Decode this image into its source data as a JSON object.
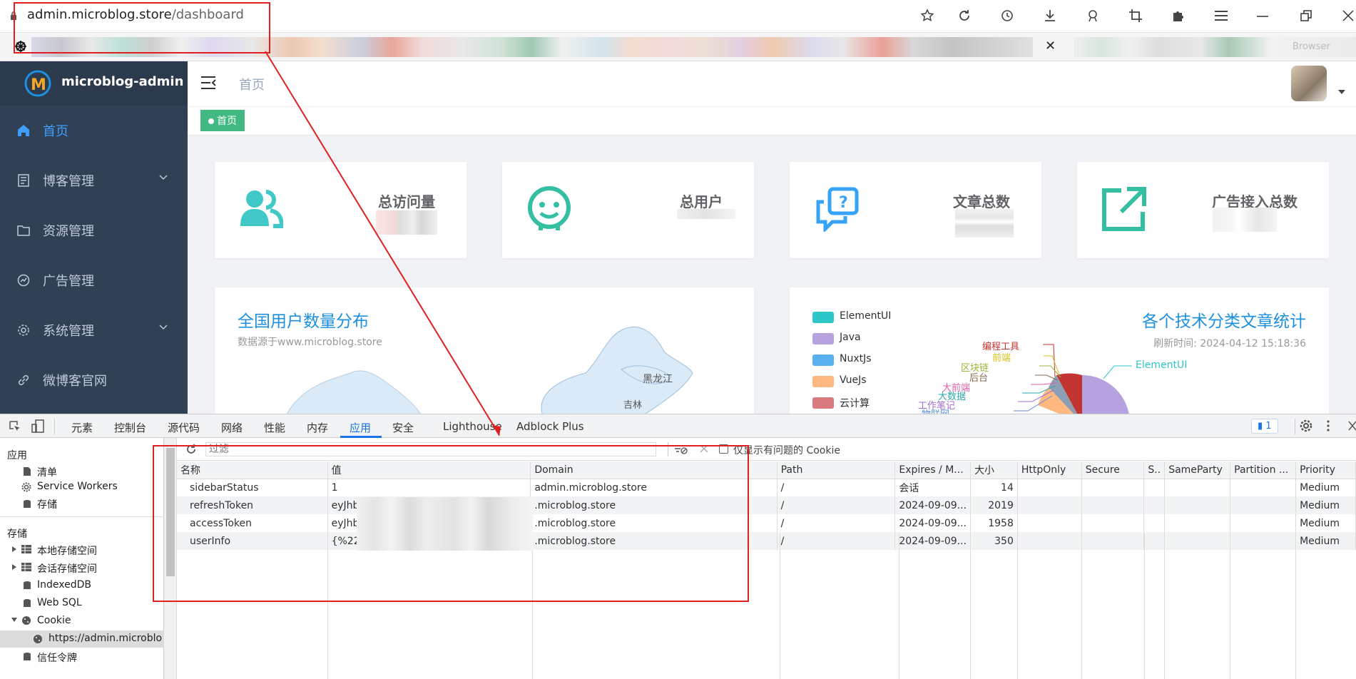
{
  "browser": {
    "url_host": "admin.microblog.store",
    "url_path": "/dashboard",
    "bookmark_fade_text": "Browser",
    "close_symbol": "✕"
  },
  "app": {
    "logo_text": "microblog-admin",
    "menu": [
      {
        "label": "首页",
        "icon": "home-icon",
        "active": true
      },
      {
        "label": "博客管理",
        "icon": "document-icon",
        "has_children": true
      },
      {
        "label": "资源管理",
        "icon": "folder-icon"
      },
      {
        "label": "广告管理",
        "icon": "dashboard-icon"
      },
      {
        "label": "系统管理",
        "icon": "gear-icon",
        "has_children": true
      },
      {
        "label": "微博客官网",
        "icon": "link-icon"
      }
    ],
    "breadcrumb": "首页",
    "tag": "首页",
    "stats": [
      {
        "title": "总访问量",
        "icon": "users-icon",
        "color": "#40c9c6"
      },
      {
        "title": "总用户",
        "icon": "robot-icon",
        "color": "#34bfa3"
      },
      {
        "title": "文章总数",
        "icon": "message-question-icon",
        "color": "#36a3f7"
      },
      {
        "title": "广告接入总数",
        "icon": "external-link-icon",
        "color": "#34bfa3"
      }
    ],
    "map_panel": {
      "title": "全国用户数量分布",
      "subtitle": "数据源于www.microblog.store",
      "labels": [
        "黑龙江",
        "吉林"
      ]
    },
    "pie_panel": {
      "title": "各个技术分类文章统计",
      "refresh": "刷新时间: 2024-04-12 15:18:36",
      "legend": [
        {
          "name": "ElementUI",
          "color": "#2ec7c9"
        },
        {
          "name": "Java",
          "color": "#b6a2de"
        },
        {
          "name": "NuxtJs",
          "color": "#5ab1ef"
        },
        {
          "name": "VueJs",
          "color": "#ffb980"
        },
        {
          "name": "云计算",
          "color": "#d87a80"
        }
      ],
      "slice_labels": [
        {
          "text": "编程工具",
          "color": "#c23531"
        },
        {
          "text": "前端",
          "color": "#d5c21b"
        },
        {
          "text": "区块链",
          "color": "#9cb43a"
        },
        {
          "text": "后台",
          "color": "#8c6a4f"
        },
        {
          "text": "大前端",
          "color": "#e060a8"
        },
        {
          "text": "大数据",
          "color": "#2ea7a8"
        },
        {
          "text": "工作笔记",
          "color": "#a06fd0"
        },
        {
          "text": "物联网",
          "color": "#5b8fd8"
        },
        {
          "text": "ElementUI",
          "color": "#2ec7c9"
        }
      ]
    }
  },
  "devtools": {
    "tabs": [
      "元素",
      "控制台",
      "源代码",
      "网络",
      "性能",
      "内存",
      "应用",
      "安全",
      "Lighthouse",
      "Adblock Plus"
    ],
    "active_tab": "应用",
    "issues_count": "1",
    "left": {
      "section_app": "应用",
      "app_items": [
        "清单",
        "Service Workers",
        "存储"
      ],
      "section_storage": "存储",
      "storage_items": [
        "本地存储空间",
        "会话存储空间",
        "IndexedDB",
        "Web SQL",
        "Cookie"
      ],
      "cookie_origin": "https://admin.microblog",
      "trust": "信任令牌"
    },
    "filter_placeholder": "过滤",
    "only_issues_label": "仅显示有问题的 Cookie",
    "columns": [
      "名称",
      "值",
      "Domain",
      "Path",
      "Expires / M...",
      "大小",
      "HttpOnly",
      "Secure",
      "S..",
      "SameParty",
      "Partition ...",
      "Priority"
    ],
    "rows": [
      {
        "name": "sidebarStatus",
        "value": "1",
        "domain": "admin.microblog.store",
        "path": "/",
        "expires": "会话",
        "size": "14",
        "priority": "Medium"
      },
      {
        "name": "refreshToken",
        "value": "eyJhb",
        "domain": ".microblog.store",
        "path": "/",
        "expires": "2024-09-09...",
        "size": "2019",
        "priority": "Medium"
      },
      {
        "name": "accessToken",
        "value": "eyJhb",
        "domain": ".microblog.store",
        "path": "/",
        "expires": "2024-09-09...",
        "size": "1958",
        "priority": "Medium"
      },
      {
        "name": "userInfo",
        "value": "{%22r",
        "domain": ".microblog.store",
        "path": "/",
        "expires": "2024-09-09...",
        "size": "350",
        "priority": "Medium"
      }
    ]
  }
}
